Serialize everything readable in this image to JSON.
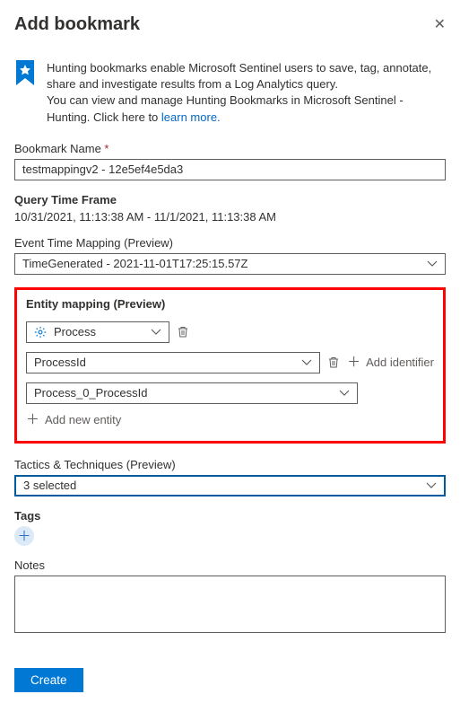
{
  "header": {
    "title": "Add bookmark"
  },
  "info": {
    "line1": "Hunting bookmarks enable Microsoft Sentinel users to save, tag, annotate, share and investigate results from a Log Analytics query.",
    "line2_prefix": "You can view and manage Hunting Bookmarks in Microsoft Sentinel - Hunting. Click here to ",
    "link": "learn more."
  },
  "bookmarkName": {
    "label": "Bookmark Name",
    "value": "testmappingv2 - 12e5ef4e5da3"
  },
  "queryTimeFrame": {
    "label": "Query Time Frame",
    "value": "10/31/2021, 11:13:38 AM - 11/1/2021, 11:13:38 AM"
  },
  "eventTimeMapping": {
    "label": "Event Time Mapping (Preview)",
    "selected": "TimeGenerated - 2021-11-01T17:25:15.57Z"
  },
  "entityMapping": {
    "label": "Entity mapping (Preview)",
    "entityType": "Process",
    "identifierKey": "ProcessId",
    "identifierValue": "Process_0_ProcessId",
    "addIdentifier": "Add identifier",
    "addNewEntity": "Add new entity"
  },
  "tactics": {
    "label": "Tactics & Techniques (Preview)",
    "selected": "3 selected"
  },
  "tags": {
    "label": "Tags"
  },
  "notes": {
    "label": "Notes",
    "value": ""
  },
  "buttons": {
    "create": "Create"
  }
}
